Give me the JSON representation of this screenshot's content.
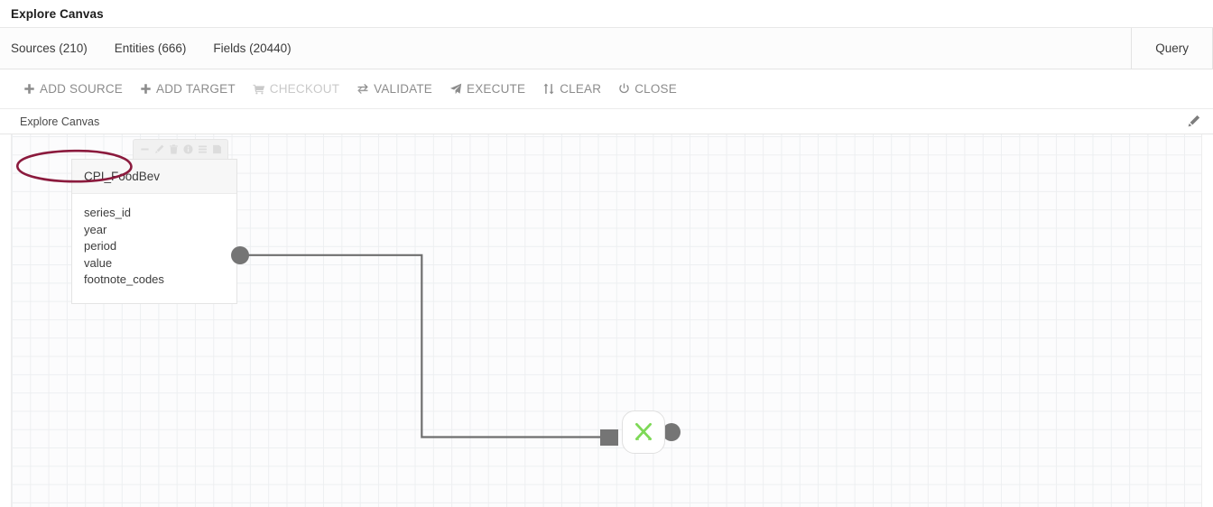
{
  "window": {
    "app_title": "Explore Canvas"
  },
  "tabbar": {
    "tabs": [
      {
        "label": "Sources (210)",
        "name": "tab-sources"
      },
      {
        "label": "Entities (666)",
        "name": "tab-entities"
      },
      {
        "label": "Fields (20440)",
        "name": "tab-fields"
      }
    ],
    "right_tab": {
      "label": "Query",
      "name": "tab-query"
    }
  },
  "toolbar": {
    "buttons": [
      {
        "label": "ADD SOURCE",
        "icon": "plus-icon",
        "disabled": false,
        "highlighted": true
      },
      {
        "label": "ADD TARGET",
        "icon": "plus-icon",
        "disabled": false,
        "highlighted": false
      },
      {
        "label": "CHECKOUT",
        "icon": "shopping-cart-icon",
        "disabled": true,
        "highlighted": false
      },
      {
        "label": "VALIDATE",
        "icon": "exchange-arrows-icon",
        "disabled": false,
        "highlighted": false
      },
      {
        "label": "EXECUTE",
        "icon": "paper-plane-icon",
        "disabled": false,
        "highlighted": false
      },
      {
        "label": "CLEAR",
        "icon": "up-down-arrows-icon",
        "disabled": false,
        "highlighted": false
      },
      {
        "label": "CLOSE",
        "icon": "power-icon",
        "disabled": false,
        "highlighted": false
      }
    ],
    "annotation_color": "#8B1A3D"
  },
  "canvas_header": {
    "title": "Explore Canvas",
    "edit_icon": "pencil-icon"
  },
  "canvas": {
    "grid_color": "#edeff1",
    "background_color": "#fcfcfd",
    "edge_color": "#6f6f6f",
    "port_color": "#757575",
    "nodes": [
      {
        "type": "source-table",
        "name": "CPI_FoodBev",
        "fields": [
          "series_id",
          "year",
          "period",
          "value",
          "footnote_codes"
        ],
        "toolbar_icons": [
          "minimize-icon",
          "pencil-icon",
          "trash-icon",
          "info-circle-icon",
          "database-layers-icon",
          "save-file-icon"
        ]
      },
      {
        "type": "transform",
        "icon": "crossed-tools-icon",
        "icon_color": "#7ed957"
      }
    ]
  }
}
